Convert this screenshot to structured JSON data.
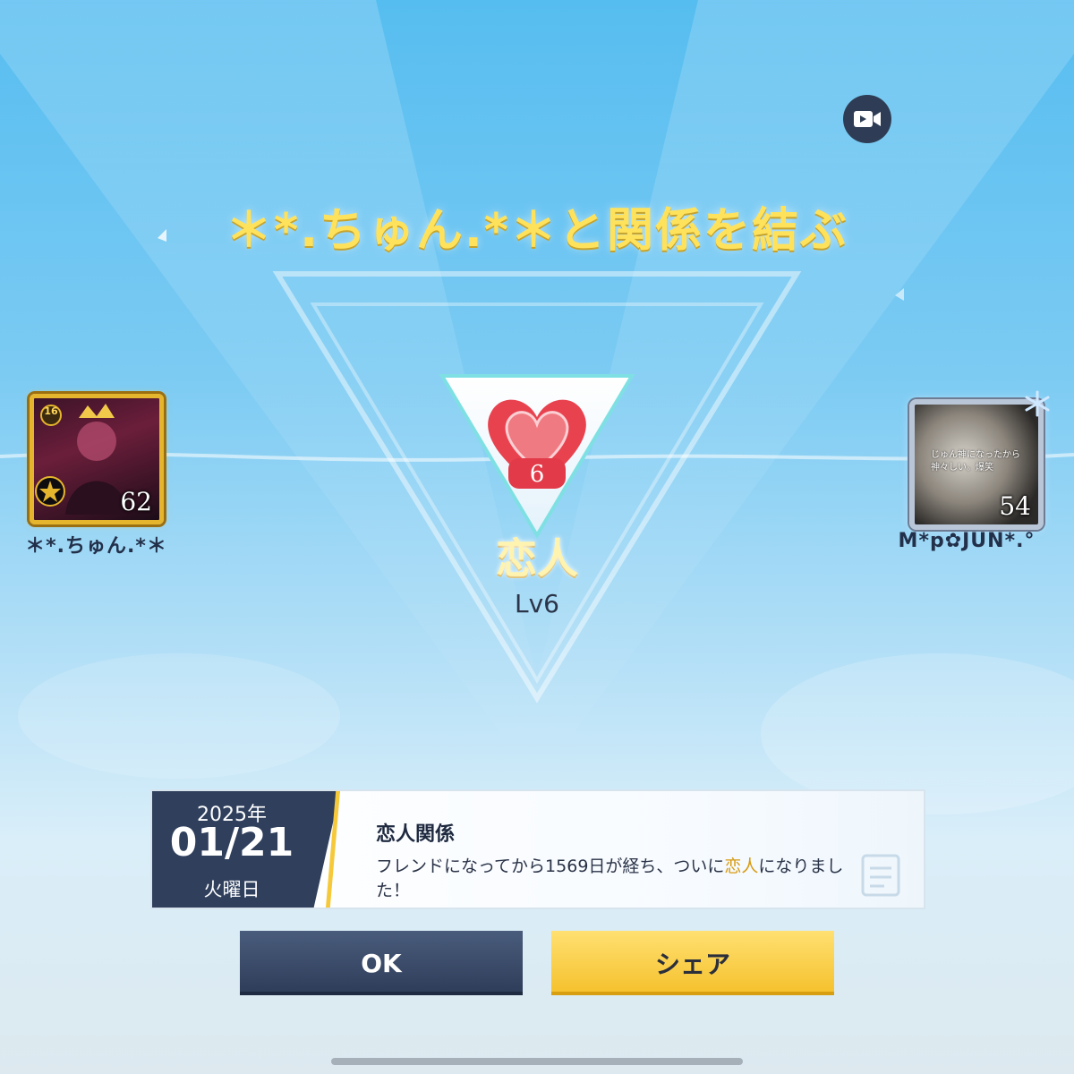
{
  "header": {
    "title": "＊*.ちゅん.*＊と関係を結ぶ",
    "record_icon": "video-record-icon"
  },
  "players": {
    "left": {
      "name": "＊*.ちゅん.*＊",
      "level": "62",
      "frame_rank": "16"
    },
    "right": {
      "name": "M*p✿JUN*.°",
      "level": "54",
      "avatar_text": "じゅん神になったから 神々しい。爆笑"
    }
  },
  "relation": {
    "badge_level": "6",
    "name": "恋人",
    "level_label": "Lv6"
  },
  "card": {
    "year": "2025年",
    "date": "01/21",
    "weekday": "火曜日",
    "title": "恋人関係",
    "message_prefix": "フレンドになってから1569日が経ち、ついに",
    "message_highlight": "恋人",
    "message_suffix": "になりました！"
  },
  "buttons": {
    "ok_label": "OK",
    "share_label": "シェア"
  },
  "colors": {
    "title_yellow": "#ffe25c",
    "ok_button": "#2d3c58",
    "share_button": "#f5c02b",
    "heart_red": "#e8424f",
    "highlight": "#d89a10"
  }
}
